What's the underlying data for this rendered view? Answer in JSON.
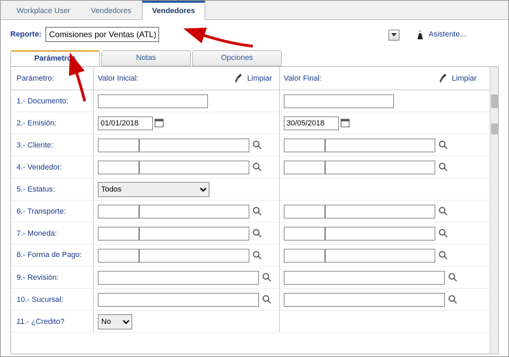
{
  "top_tabs": {
    "workplace": "Workplace User",
    "vend1": "Vendedores",
    "vend2": "Vendedores"
  },
  "report": {
    "label": "Reporte:",
    "value": "Comisiones por Ventas (ATL)",
    "asistente": "Asistente..."
  },
  "sub_tabs": {
    "param": "Parámetros",
    "notas": "Notas",
    "opciones": "Opciones"
  },
  "headers": {
    "parametro": "Parámetro:",
    "valor_inicial": "Valor Inicial:",
    "valor_final": "Valor Final:",
    "limpiar": "Limpiar"
  },
  "params": {
    "p1": "1.- Documento:",
    "p2": "2.- Emisión:",
    "p3": "3.- Cliente:",
    "p4": "4.- Vendedor:",
    "p5": "5.- Estatus:",
    "p6": "6.- Transporte:",
    "p7": "7.- Moneda:",
    "p8": "8.- Forma de Pago:",
    "p9": "9.- Revisión:",
    "p10": "10.- Sucursal:",
    "p11": "11.- ¿Credito?"
  },
  "values": {
    "emision_ini": "01/01/2018",
    "emision_fin": "30/05/2018",
    "estatus": "Todos",
    "credito": "No"
  }
}
